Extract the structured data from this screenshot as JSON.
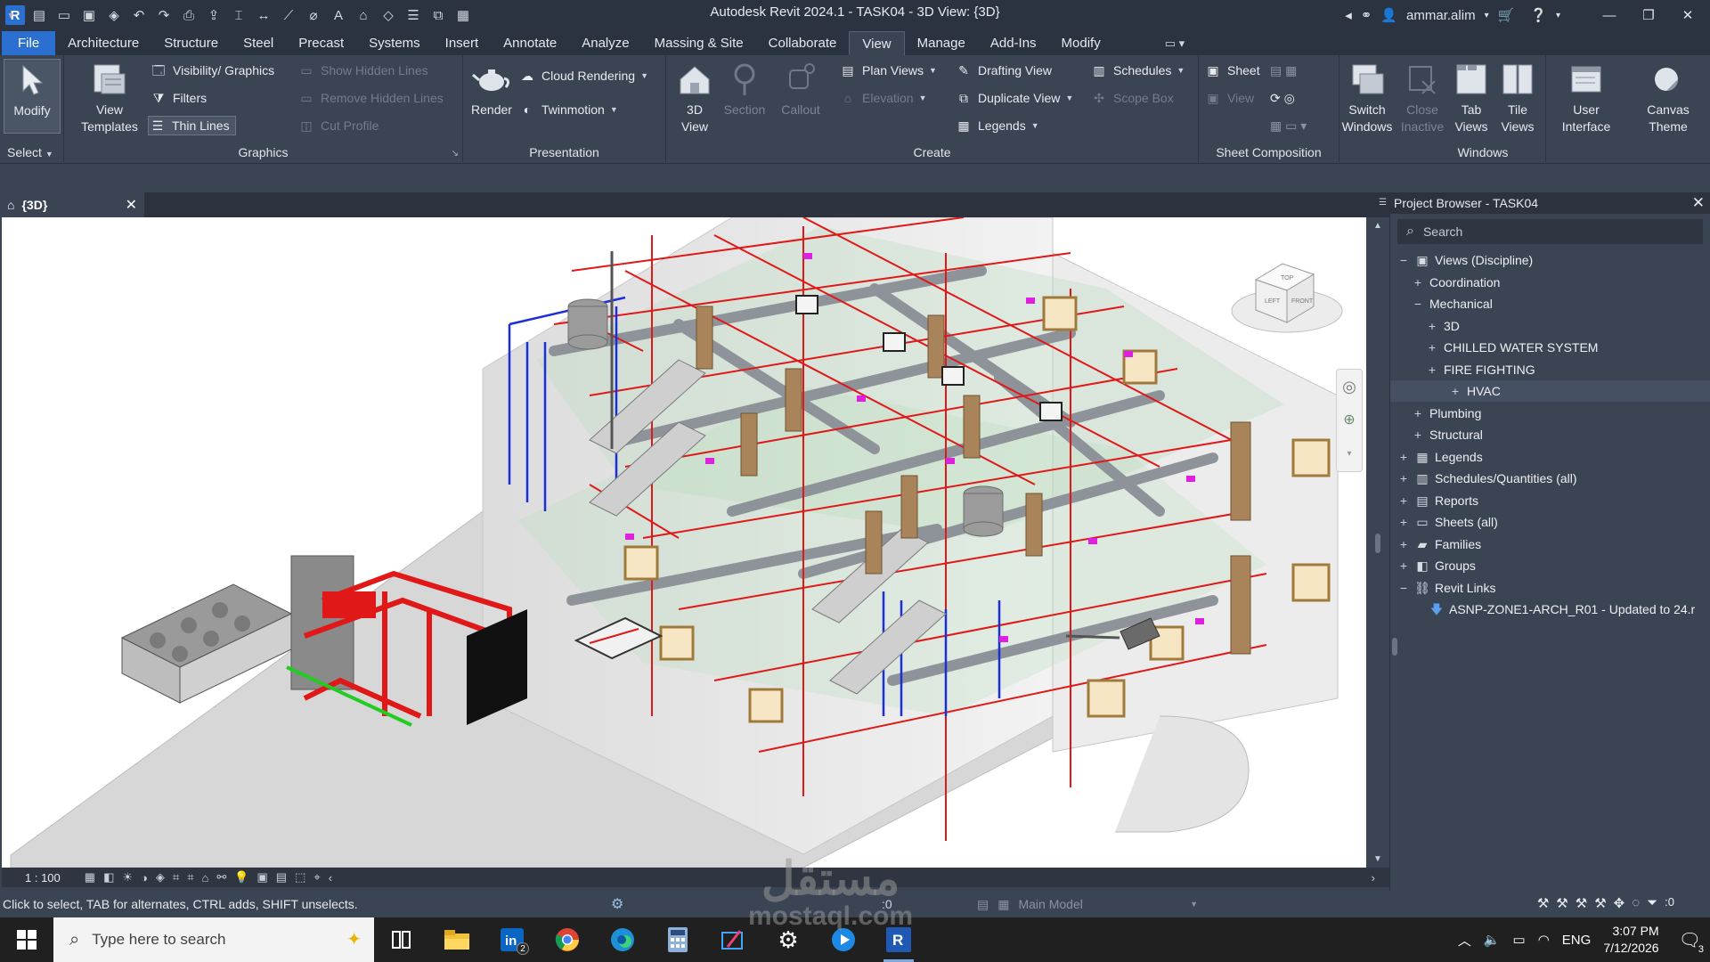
{
  "titlebar": {
    "app_title": "Autodesk Revit 2024.1 - TASK04 - 3D View: {3D}",
    "user": "ammar.alim"
  },
  "tabs": {
    "file": "File",
    "items": [
      "Architecture",
      "Structure",
      "Steel",
      "Precast",
      "Systems",
      "Insert",
      "Annotate",
      "Analyze",
      "Massing & Site",
      "Collaborate",
      "View",
      "Manage",
      "Add-Ins",
      "Modify"
    ],
    "active": "View"
  },
  "ribbon": {
    "select": {
      "modify": "Modify",
      "panel": "Select"
    },
    "graphics": {
      "view_templates_1": "View",
      "view_templates_2": "Templates",
      "visibility_graphics": "Visibility/ Graphics",
      "filters": "Filters",
      "thin_lines": "Thin Lines",
      "show_hidden_lines": "Show Hidden Lines",
      "remove_hidden_lines": "Remove Hidden Lines",
      "cut_profile": "Cut Profile",
      "panel": "Graphics"
    },
    "presentation": {
      "render": "Render",
      "cloud_rendering": "Cloud Rendering",
      "twinmotion": "Twinmotion",
      "panel": "Presentation"
    },
    "create": {
      "view3d_1": "3D",
      "view3d_2": "View",
      "section": "Section",
      "callout": "Callout",
      "plan_views": "Plan Views",
      "elevation": "Elevation",
      "drafting_view": "Drafting View",
      "duplicate_view": "Duplicate View",
      "legends": "Legends",
      "schedules": "Schedules",
      "scope_box": "Scope Box",
      "panel": "Create"
    },
    "sheet": {
      "sheet": "Sheet",
      "view": "View",
      "panel": "Sheet Composition"
    },
    "windows": {
      "switch_1": "Switch",
      "switch_2": "Windows",
      "close_1": "Close",
      "close_2": "Inactive",
      "tab_1": "Tab",
      "tab_2": "Views",
      "tile_1": "Tile",
      "tile_2": "Views",
      "panel": "Windows"
    },
    "ui": {
      "user_1": "User",
      "user_2": "Interface",
      "canvas_1": "Canvas",
      "canvas_2": "Theme"
    }
  },
  "view": {
    "tab_label": "{3D}",
    "scale": "1 : 100"
  },
  "viewcube": {
    "top": "TOP",
    "left": "LEFT",
    "front": "FRONT"
  },
  "status": {
    "message": "Click to select, TAB for alternates, CTRL adds, SHIFT unselects.",
    "workset_count": ":0",
    "model": "Main Model",
    "filter_count": ":0"
  },
  "project_browser": {
    "title": "Project Browser - TASK04",
    "search_placeholder": "Search",
    "items": [
      {
        "label": "Views (Discipline)",
        "level": 0,
        "toggle": "−",
        "icon": "views"
      },
      {
        "label": "Coordination",
        "level": 1,
        "toggle": "+"
      },
      {
        "label": "Mechanical",
        "level": 1,
        "toggle": "−"
      },
      {
        "label": "3D",
        "level": 2,
        "toggle": "+"
      },
      {
        "label": "CHILLED WATER SYSTEM",
        "level": 2,
        "toggle": "+"
      },
      {
        "label": "FIRE FIGHTING",
        "level": 2,
        "toggle": "+"
      },
      {
        "label": "HVAC",
        "level": 2,
        "toggle": "+"
      },
      {
        "label": "Plumbing",
        "level": 1,
        "toggle": "+"
      },
      {
        "label": "Structural",
        "level": 1,
        "toggle": "+"
      },
      {
        "label": "Legends",
        "level": 0,
        "toggle": "+",
        "icon": "legend"
      },
      {
        "label": "Schedules/Quantities (all)",
        "level": 0,
        "toggle": "+",
        "icon": "schedule"
      },
      {
        "label": "Reports",
        "level": 0,
        "toggle": "+",
        "icon": "report"
      },
      {
        "label": "Sheets (all)",
        "level": 0,
        "toggle": "+",
        "icon": "sheet"
      },
      {
        "label": "Families",
        "level": 0,
        "toggle": "+",
        "icon": "family"
      },
      {
        "label": "Groups",
        "level": 0,
        "toggle": "+",
        "icon": "group"
      },
      {
        "label": "Revit Links",
        "level": 0,
        "toggle": "−",
        "icon": "link"
      },
      {
        "label": "ASNP-ZONE1-ARCH_R01 - Updated to 24.r",
        "level": 1,
        "toggle": "",
        "icon": "arrow"
      }
    ]
  },
  "taskbar": {
    "search_placeholder": "Type here to search",
    "linkedin_badge": "2",
    "language": "ENG",
    "time": "3:07 PM",
    "date": "7/12/2026",
    "notification_count": "3"
  },
  "watermark": {
    "arabic": "مستقل",
    "latin": "mostaql.com"
  },
  "colors": {
    "ribbon_bg": "#3b4453",
    "titlebar_bg": "#2b3340",
    "file_tab": "#2b6fd1",
    "fire_pipe": "#e01818",
    "water_pipe": "#1a2fd8",
    "duct": "#8e939a"
  }
}
